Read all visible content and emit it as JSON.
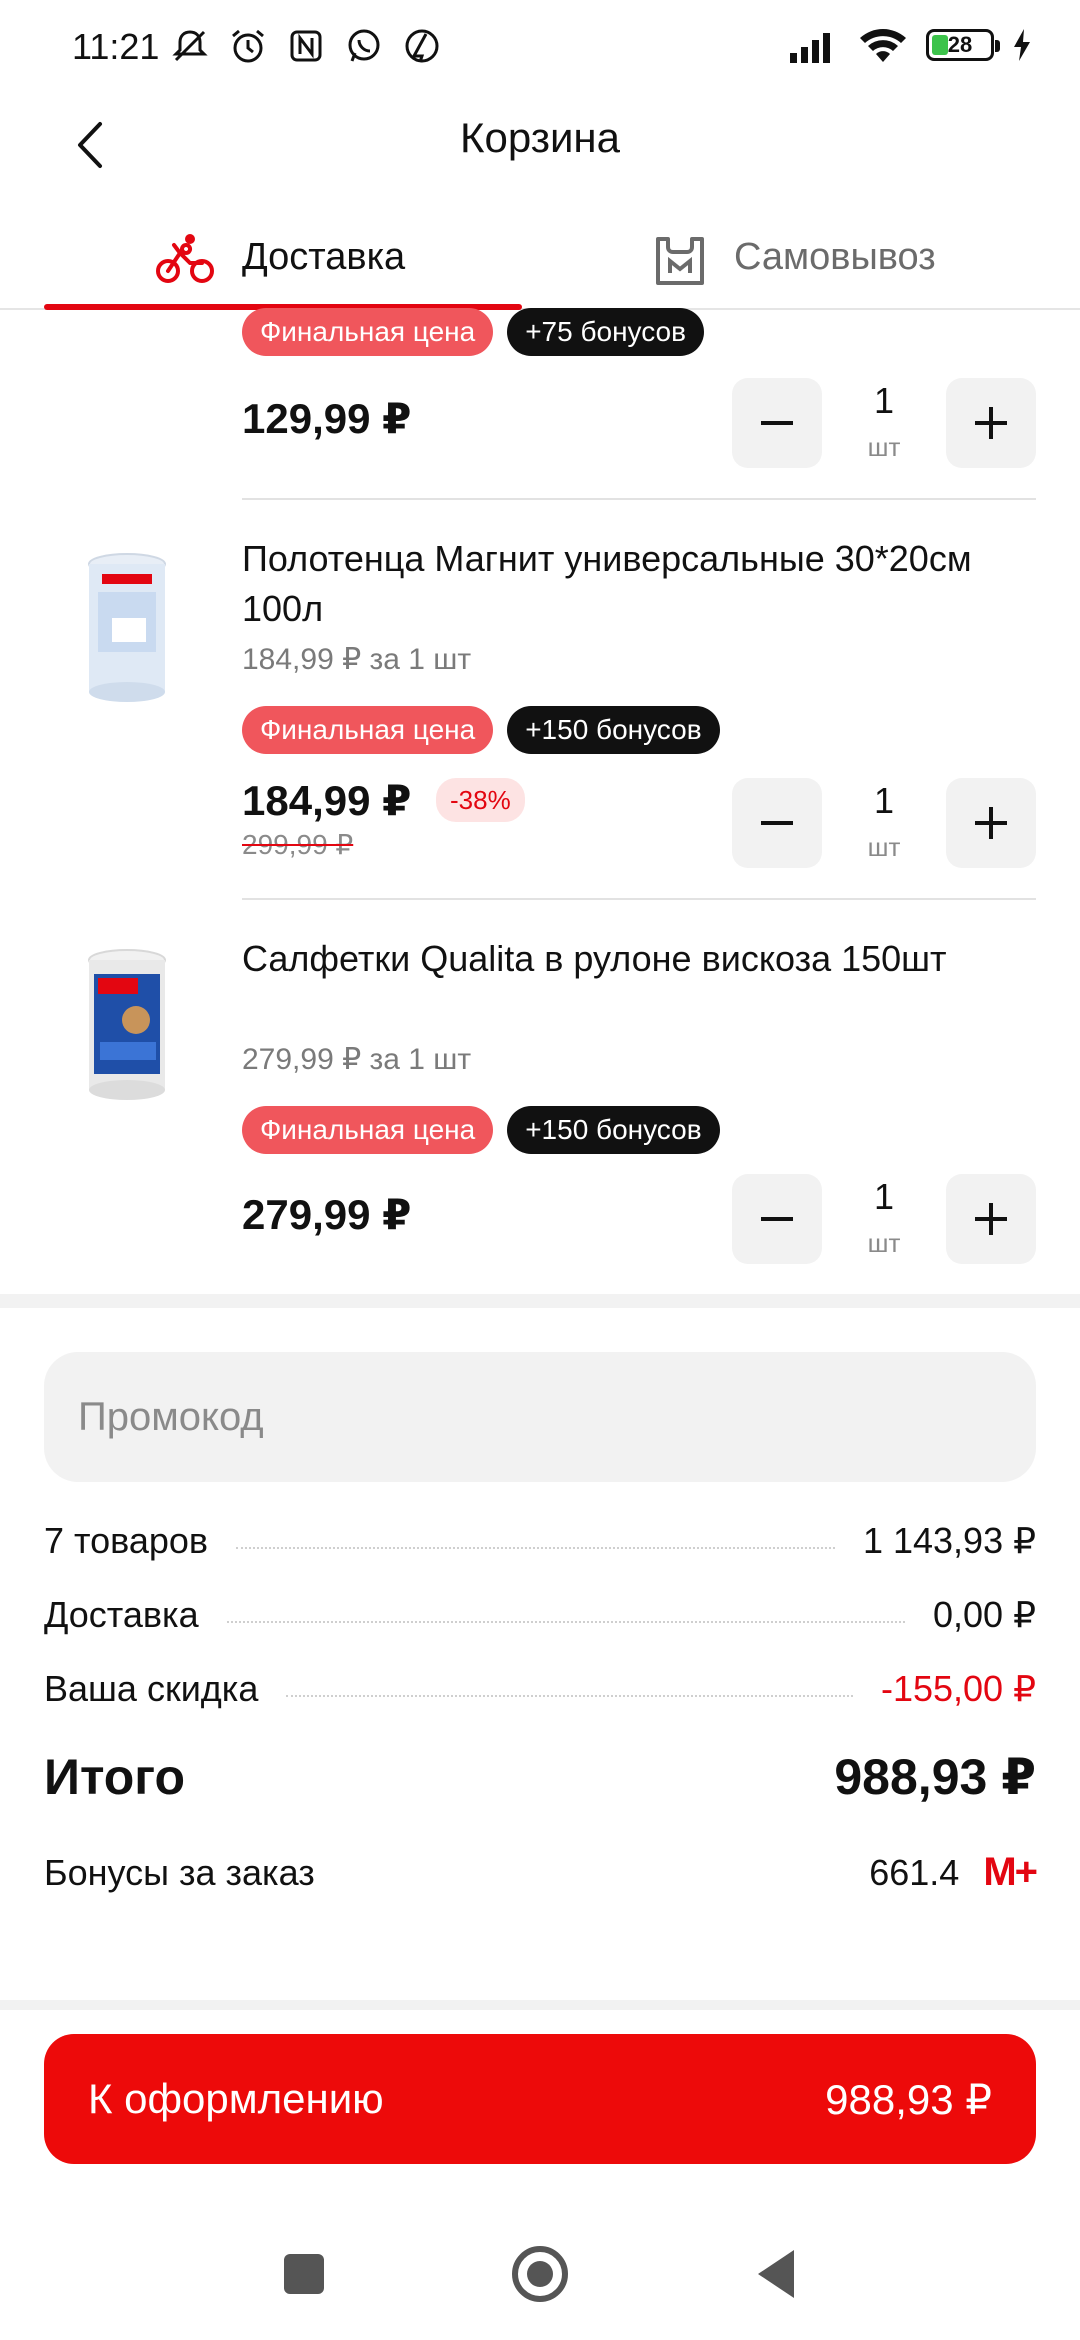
{
  "status_bar": {
    "time": "11:21",
    "battery_level": "28",
    "icons": [
      "mute-icon",
      "alarm-icon",
      "nfc-icon",
      "whatsapp-icon",
      "app-icon",
      "signal-icon",
      "wifi-icon",
      "battery-icon",
      "charging-icon"
    ]
  },
  "header": {
    "title": "Корзина"
  },
  "tabs": [
    {
      "label": "Доставка",
      "active": true,
      "icon": "bicycle-icon"
    },
    {
      "label": "Самовывоз",
      "active": false,
      "icon": "bag-icon"
    }
  ],
  "products": [
    {
      "final_badge": "Финальная цена",
      "bonus_badge": "+75 бонусов",
      "price": "129,99 ₽",
      "qty": "1",
      "qty_unit": "шт"
    },
    {
      "name": "Полотенца Магнит универсальные 30*20см 100л",
      "unit_price": "184,99 ₽ за 1 шт",
      "final_badge": "Финальная цена",
      "bonus_badge": "+150 бонусов",
      "price": "184,99 ₽",
      "old_price": "299,99 ₽",
      "discount": "-38%",
      "qty": "1",
      "qty_unit": "шт"
    },
    {
      "name": "Салфетки Qualita в рулоне вискоза 150шт",
      "unit_price": "279,99 ₽ за 1 шт",
      "final_badge": "Финальная цена",
      "bonus_badge": "+150 бонусов",
      "price": "279,99 ₽",
      "qty": "1",
      "qty_unit": "шт"
    }
  ],
  "promo": {
    "placeholder": "Промокод"
  },
  "summary": {
    "items_label": "7 товаров",
    "items_value": "1 143,93 ₽",
    "delivery_label": "Доставка",
    "delivery_value": "0,00 ₽",
    "discount_label": "Ваша скидка",
    "discount_value": "-155,00 ₽",
    "total_label": "Итого",
    "total_value": "988,93 ₽",
    "bonus_label": "Бонусы за заказ",
    "bonus_value": "661.4",
    "bonus_brand": "M+"
  },
  "checkout": {
    "label": "К оформлению",
    "amount": "988,93 ₽"
  },
  "colors": {
    "accent": "#e30611",
    "button": "#ed0a0a",
    "badge_red": "#f0565c",
    "badge_black": "#111111"
  }
}
